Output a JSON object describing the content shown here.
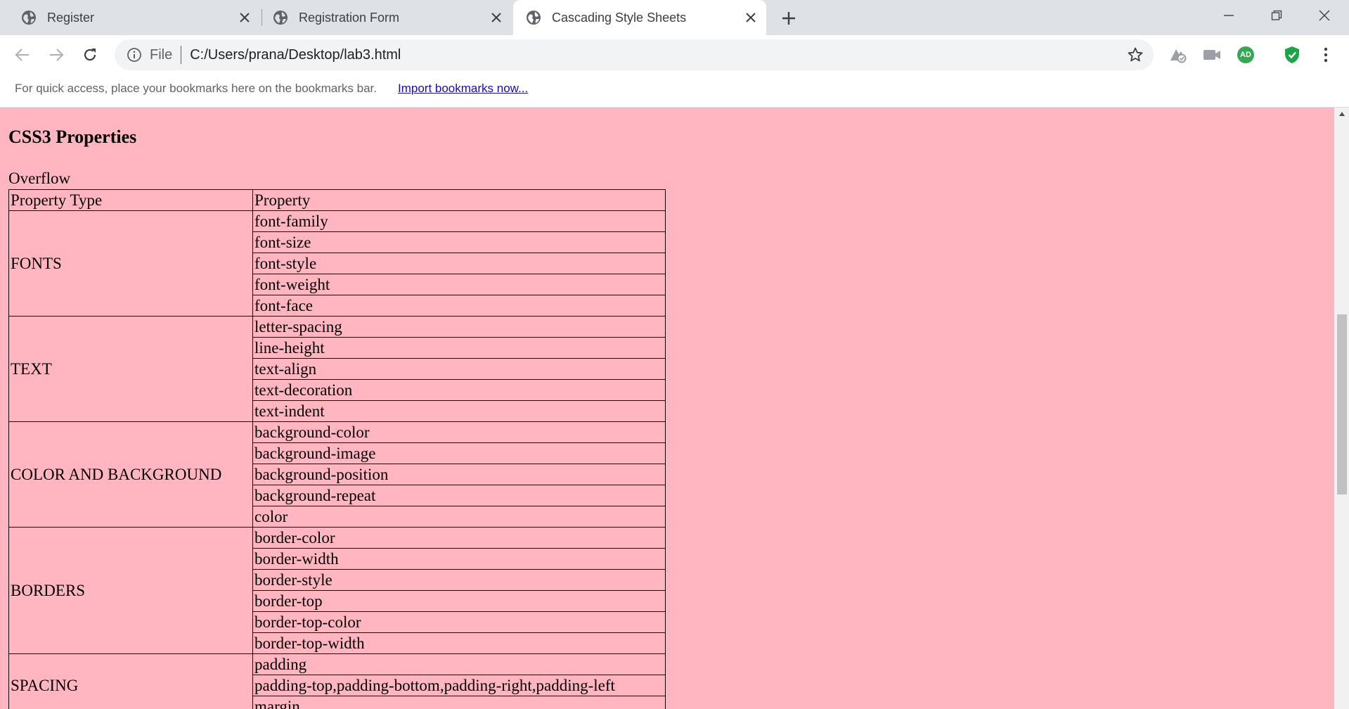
{
  "browser": {
    "tabs": [
      {
        "title": "Register",
        "active": false
      },
      {
        "title": "Registration Form",
        "active": false
      },
      {
        "title": "Cascading Style Sheets",
        "active": true
      }
    ],
    "omnibox": {
      "scheme": "File",
      "url": "C:/Users/prana/Desktop/lab3.html"
    },
    "extensions": {
      "adblock_label": "AD"
    },
    "bookmarks_bar": {
      "message": "For quick access, place your bookmarks here on the bookmarks bar.",
      "import_link": "Import bookmarks now..."
    }
  },
  "page": {
    "background_color": "#ffb6c1",
    "heading": "CSS3 Properties",
    "caption": "Overflow",
    "table": {
      "headers": [
        "Property Type",
        "Property"
      ],
      "groups": [
        {
          "type": "FONTS",
          "properties": [
            "font-family",
            "font-size",
            "font-style",
            "font-weight",
            "font-face"
          ]
        },
        {
          "type": "TEXT",
          "properties": [
            "letter-spacing",
            "line-height",
            "text-align",
            "text-decoration",
            "text-indent"
          ]
        },
        {
          "type": "COLOR AND BACKGROUND",
          "properties": [
            "background-color",
            "background-image",
            "background-position",
            "background-repeat",
            "color"
          ]
        },
        {
          "type": "BORDERS",
          "properties": [
            "border-color",
            "border-width",
            "border-style",
            "border-top",
            "border-top-color",
            "border-top-width"
          ]
        },
        {
          "type": "SPACING",
          "properties": [
            "padding",
            "padding-top,padding-bottom,padding-right,padding-left",
            "margin"
          ]
        }
      ]
    }
  },
  "colors": {
    "tabstrip": "#dee1e6",
    "page_background": "#ffb6c1",
    "adblock_green": "#34a853",
    "shield_green": "#1ea446"
  }
}
